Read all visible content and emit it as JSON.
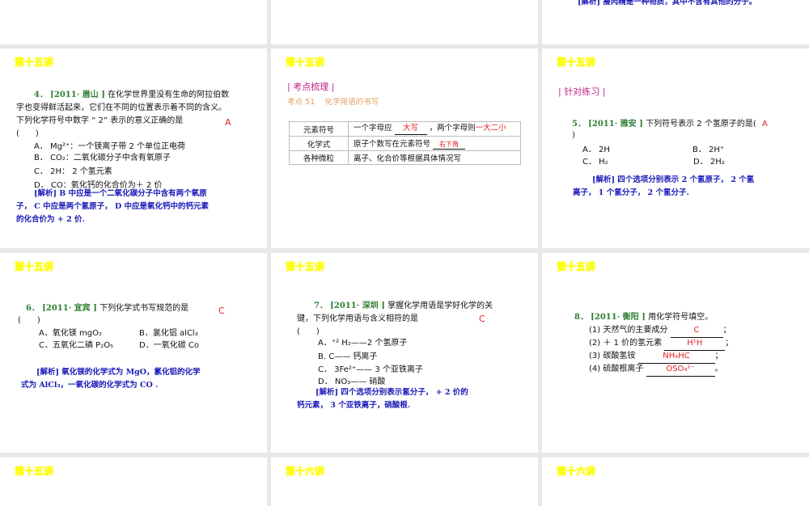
{
  "slides": [
    {
      "analysis": "[解析] 瘦肉精是一种物质，其中不含有其他的分子。"
    },
    {},
    {},
    {
      "header": "第十五讲",
      "q_num": "4．",
      "q_src": "[2011· 眉山 ]",
      "q_line1": "在化学世界里没有生命的阿拉伯数",
      "q_line2": "字也变得鲜活起来，它们在不同的位置表示着不同的含义。",
      "q_line3": "下列化学符号中数字 “ 2” 表示的意义正确的是",
      "q_paren": "(　　)",
      "answer": "A",
      "options": [
        "A． Mg²⁺：一个镁离子带 2 个单位正电荷",
        "B． CO₂：二氧化碳分子中含有氧原子",
        "C． 2H： 2 个氢元素",
        "D． CO：氧化钙的化合价为＋ 2 价"
      ],
      "analysis": [
        "[解析] B 中应是一个二氧化碳分子中含有两个氧原",
        "子， C 中应是两个氢原子， D 中应是氧化钙中的钙元素",
        "的化合价为 + 2 价."
      ]
    },
    {
      "header": "第十五讲",
      "section": "| 考点梳理 |",
      "topic": "考点 51　 化学用语的书写",
      "table": [
        [
          "元素符号",
          "一个字母应",
          "大写",
          "，两个字母则",
          "一大二小",
          "右下角"
        ],
        [
          "化学式",
          "原子个数写在元素符号"
        ],
        [
          "各种微粒",
          "离子、化合价等根据具体情况写"
        ]
      ]
    },
    {
      "header": "第十五讲",
      "section": "| 针对练习 |",
      "q_num": "5．",
      "q_src": "[2011· 雅安 ]",
      "q_text": "下列符号表示 2 个氢原子的是(",
      "q_paren": ")",
      "answer": "A",
      "options": [
        "A． 2H",
        "B． 2H⁺",
        "C． H₂",
        "D． 2H₂"
      ],
      "analysis": [
        "[解析] 四个选项分别表示 2 个氢原子， 2 个氢",
        "离子， 1 个氢分子， 2 个氢分子."
      ]
    },
    {
      "header": "第十五讲",
      "q_num": "6．",
      "q_src": "[2011· 宜宾 ]",
      "q_text": "下列化学式书写规范的是",
      "q_paren": "(　　)",
      "answer": "C",
      "options": [
        "A．氧化镁 mgO₂",
        "B．氯化铝 alCl₃",
        "C．五氧化二磷 P₂O₅",
        "D．一氧化碳 Co"
      ],
      "analysis": [
        "[解析] 氧化镁的化学式为 MgO，氯化铝的化学",
        "式为 AlCl₃，一氧化碳的化学式为 CO ."
      ]
    },
    {
      "header": "第十五讲",
      "q_num": "7．",
      "q_src": "[2011· 深圳 ]",
      "q_line1": "掌握化学用语是学好化学的关",
      "q_line2": "键，下列化学用语与含义相符的是",
      "q_paren": "(　　)",
      "answer": "C",
      "options": [
        "A．⁺² H₂——2 个氢原子",
        "B. C—— 钙离子",
        "C． 3Fe²⁺—— 3 个亚铁离子",
        "D． NO₃—— 硝酸"
      ],
      "analysis": [
        "[解析] 四个选项分别表示氢分子， + 2 价的",
        "钙元素， 3 个亚铁离子，硝酸根."
      ]
    },
    {
      "header": "第十五讲",
      "q_num": "8．",
      "q_src": "[2011· 衡阳 ]",
      "q_text": "用化学符号填空。",
      "items": [
        {
          "label": "(1) 天然气的主要成分",
          "answer": "C",
          "end": "；"
        },
        {
          "label": "(2) ＋ 1 价的氢元素",
          "answer": "H¹H",
          "end": "；"
        },
        {
          "label": "(3) 碳酸氢铵",
          "answer": "NH₄HC",
          "end": "；"
        },
        {
          "label": "(4) 硫酸根离子",
          "answer": "OSO₄²⁻",
          "end": "。"
        }
      ]
    },
    {
      "header": "第十五讲"
    },
    {
      "header": "第十六讲"
    },
    {
      "header": "第十六讲"
    }
  ]
}
